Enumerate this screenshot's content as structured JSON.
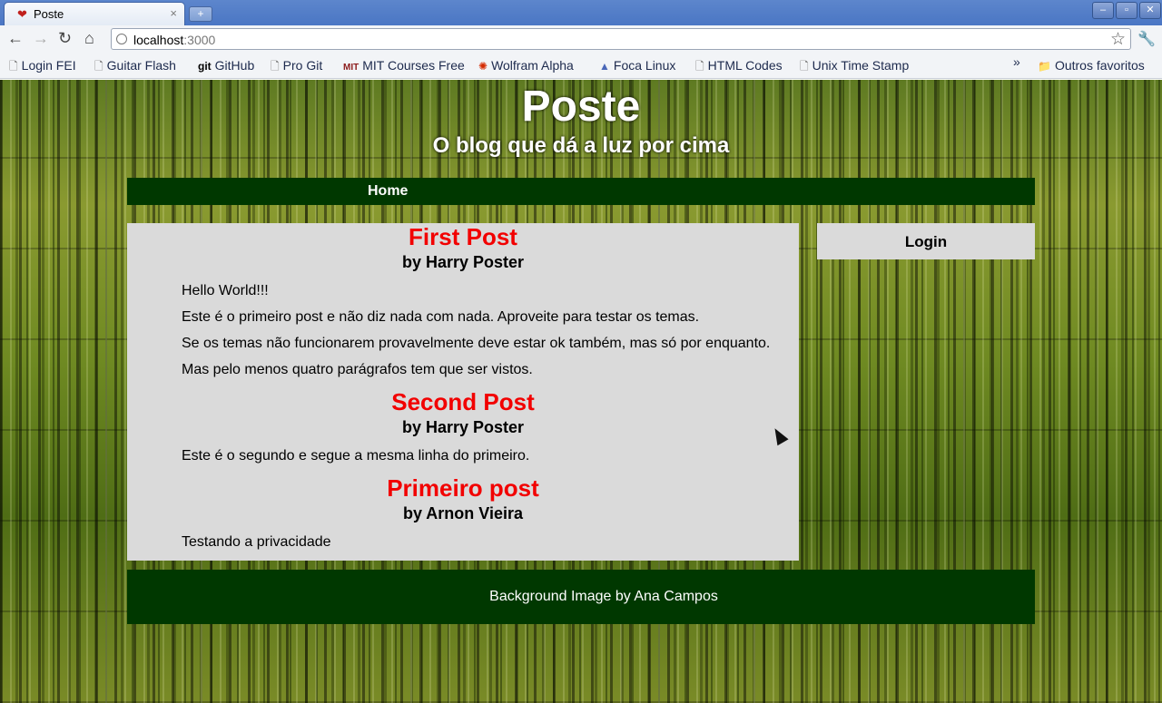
{
  "browser": {
    "tab_title": "Poste",
    "tab_close": "×",
    "new_tab": "+",
    "window_controls": {
      "minimize": "–",
      "restore": "▫",
      "close": "✕"
    },
    "nav": {
      "back": "←",
      "forward": "→",
      "reload": "↻",
      "home": "⌂"
    },
    "url_host": "localhost",
    "url_port": ":3000",
    "bookmarks": [
      {
        "label": "Login FEI",
        "icon": "page-icon"
      },
      {
        "label": "Guitar Flash",
        "icon": "page-icon"
      },
      {
        "label": "GitHub",
        "icon": "git-icon"
      },
      {
        "label": "Pro Git",
        "icon": "page-icon"
      },
      {
        "label": "MIT Courses Free",
        "icon": "mit-icon"
      },
      {
        "label": "Wolfram Alpha",
        "icon": "wolfram-icon"
      },
      {
        "label": "Foca Linux",
        "icon": "foca-icon"
      },
      {
        "label": "HTML Codes",
        "icon": "page-icon"
      },
      {
        "label": "Unix Time Stamp",
        "icon": "page-icon"
      }
    ],
    "more_bookmarks": "»",
    "other_bookmarks": "Outros favoritos"
  },
  "site": {
    "title": "Poste",
    "subtitle": "O blog que dá a luz por cima",
    "nav_home": "Home",
    "login": "Login",
    "footer": "Background Image by Ana Campos"
  },
  "posts": [
    {
      "title": "First Post",
      "author": "by Harry Poster",
      "paragraphs": [
        "Hello World!!!",
        "Este é o primeiro post e não diz nada com nada. Aproveite para testar os temas.",
        "Se os temas não funcionarem provavelmente deve estar ok também, mas só por enquanto.",
        "Mas pelo menos quatro parágrafos tem que ser vistos."
      ]
    },
    {
      "title": "Second Post",
      "author": "by Harry Poster",
      "paragraphs": [
        "Este é o segundo e segue a mesma linha do primeiro."
      ]
    },
    {
      "title": "Primeiro post",
      "author": "by Arnon Vieira",
      "paragraphs": [
        "Testando a privacidade"
      ]
    }
  ],
  "colors": {
    "post_title": "#f20000",
    "nav_bg": "#003800",
    "content_bg": "#dadada"
  }
}
